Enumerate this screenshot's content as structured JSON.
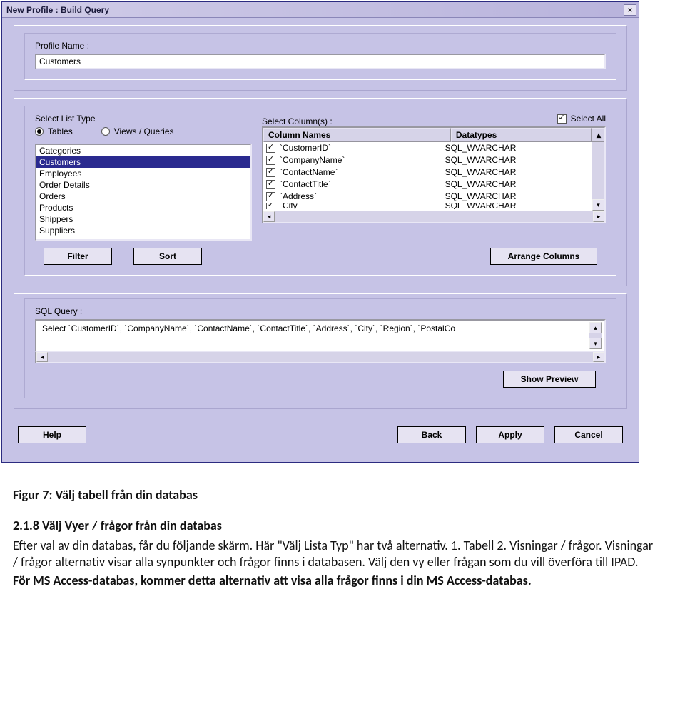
{
  "window": {
    "title": "New Profile : Build Query",
    "close": "×"
  },
  "profile": {
    "label": "Profile Name :",
    "value": "Customers"
  },
  "listType": {
    "label": "Select List Type",
    "options": {
      "tables": "Tables",
      "views": "Views / Queries"
    },
    "selected": "tables",
    "items": [
      "Categories",
      "Customers",
      "Employees",
      "Order Details",
      "Orders",
      "Products",
      "Shippers",
      "Suppliers"
    ],
    "selectedItem": "Customers"
  },
  "columns": {
    "label": "Select Column(s) :",
    "selectAllLabel": "Select All",
    "selectAllChecked": true,
    "headers": {
      "name": "Column Names",
      "type": "Datatypes"
    },
    "rows": [
      {
        "checked": true,
        "name": "`CustomerID`",
        "type": "SQL_WVARCHAR"
      },
      {
        "checked": true,
        "name": "`CompanyName`",
        "type": "SQL_WVARCHAR"
      },
      {
        "checked": true,
        "name": "`ContactName`",
        "type": "SQL_WVARCHAR"
      },
      {
        "checked": true,
        "name": "`ContactTitle`",
        "type": "SQL_WVARCHAR"
      },
      {
        "checked": true,
        "name": "`Address`",
        "type": "SQL_WVARCHAR"
      },
      {
        "checked": true,
        "name": "`City`",
        "type": "SQL_WVARCHAR"
      }
    ]
  },
  "buttons": {
    "filter": "Filter",
    "sort": "Sort",
    "arrange": "Arrange Columns",
    "showPreview": "Show Preview",
    "help": "Help",
    "back": "Back",
    "apply": "Apply",
    "cancel": "Cancel"
  },
  "sql": {
    "label": "SQL Query :",
    "value": "Select `CustomerID`, `CompanyName`, `ContactName`, `ContactTitle`, `Address`, `City`, `Region`, `PostalCo"
  },
  "document": {
    "caption": "Figur 7: Välj tabell från din databas",
    "heading": "2.1.8 Välj Vyer / frågor från din databas",
    "p1": "Efter val av din databas, får du följande skärm. Här \"Välj Lista Typ\" har två alternativ. 1. Tabell 2. Visningar / frågor. Visningar / frågor alternativ visar alla synpunkter och frågor finns i databasen. Välj den vy eller frågan som du vill överföra till IPAD.",
    "p2": "För MS Access-databas, kommer detta alternativ att visa alla frågor finns i din MS Access-databas."
  }
}
